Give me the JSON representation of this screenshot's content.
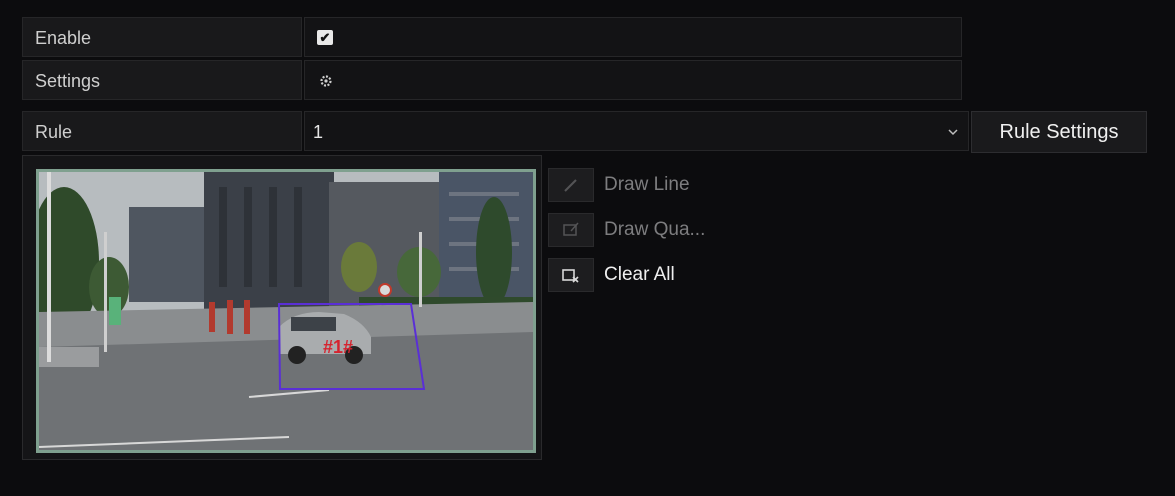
{
  "form": {
    "enable_label": "Enable",
    "enable_checked": true,
    "settings_label": "Settings",
    "settings_icon": "gear-icon",
    "rule_label": "Rule",
    "rule_value": "1",
    "rule_settings_button": "Rule Settings"
  },
  "tools": {
    "draw_line": "Draw Line",
    "draw_quad": "Draw Qua...",
    "clear_all": "Clear All"
  },
  "video": {
    "region_label": "#1#",
    "region_color": "#5a2fd6"
  }
}
